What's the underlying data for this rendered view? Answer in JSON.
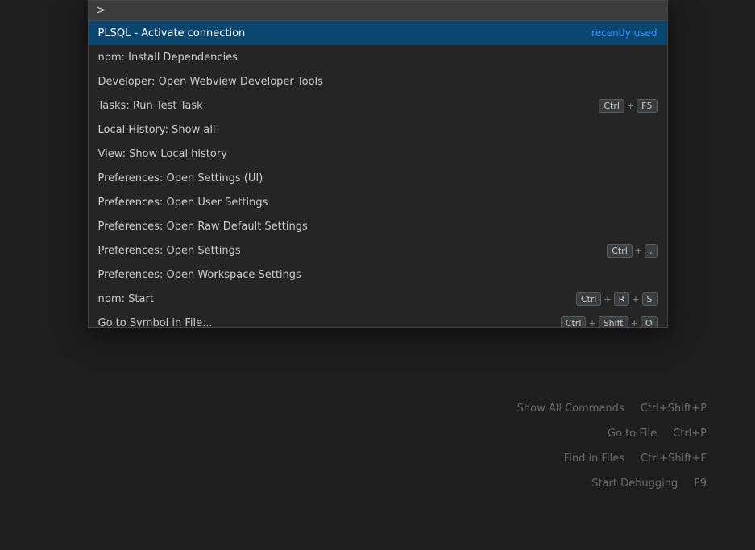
{
  "background": {
    "color": "#1e1e1e"
  },
  "commandPalette": {
    "searchBar": {
      "prefix": ">",
      "placeholder": "",
      "value": ""
    },
    "commands": [
      {
        "id": "plsql-activate",
        "name": "PLSQL - Activate connection",
        "badge": "recently used",
        "keybinding": null,
        "selected": true
      },
      {
        "id": "npm-install",
        "name": "npm: Install Dependencies",
        "badge": null,
        "keybinding": null,
        "selected": false
      },
      {
        "id": "dev-open-webview",
        "name": "Developer: Open Webview Developer Tools",
        "badge": null,
        "keybinding": null,
        "selected": false
      },
      {
        "id": "tasks-run-test",
        "name": "Tasks: Run Test Task",
        "badge": null,
        "keybinding": [
          {
            "key": "Ctrl"
          },
          {
            "sep": "+"
          },
          {
            "key": "F5"
          }
        ],
        "selected": false
      },
      {
        "id": "local-history-show-all",
        "name": "Local History: Show all",
        "badge": null,
        "keybinding": null,
        "selected": false
      },
      {
        "id": "view-show-local-history",
        "name": "View: Show Local history",
        "badge": null,
        "keybinding": null,
        "selected": false
      },
      {
        "id": "prefs-open-settings-ui",
        "name": "Preferences: Open Settings (UI)",
        "badge": null,
        "keybinding": null,
        "selected": false
      },
      {
        "id": "prefs-open-user-settings",
        "name": "Preferences: Open User Settings",
        "badge": null,
        "keybinding": null,
        "selected": false
      },
      {
        "id": "prefs-open-raw-default",
        "name": "Preferences: Open Raw Default Settings",
        "badge": null,
        "keybinding": null,
        "selected": false
      },
      {
        "id": "prefs-open-settings",
        "name": "Preferences: Open Settings",
        "badge": null,
        "keybinding": [
          {
            "key": "Ctrl"
          },
          {
            "sep": "+"
          },
          {
            "key": ","
          }
        ],
        "selected": false
      },
      {
        "id": "prefs-open-workspace",
        "name": "Preferences: Open Workspace Settings",
        "badge": null,
        "keybinding": null,
        "selected": false
      },
      {
        "id": "npm-start",
        "name": "npm: Start",
        "badge": null,
        "keybinding": [
          {
            "key": "Ctrl"
          },
          {
            "sep": "+"
          },
          {
            "key": "R"
          },
          {
            "sep": "+"
          },
          {
            "key": "S"
          }
        ],
        "selected": false
      },
      {
        "id": "go-to-symbol",
        "name": "Go to Symbol in File...",
        "badge": null,
        "keybinding": [
          {
            "key": "Ctrl"
          },
          {
            "sep": "+"
          },
          {
            "key": "Shift"
          },
          {
            "sep": "+"
          },
          {
            "key": "O"
          }
        ],
        "selected": false
      }
    ]
  },
  "hints": [
    {
      "label": "Show All Commands",
      "shortcut": "Ctrl+Shift+P"
    },
    {
      "label": "Go to File",
      "shortcut": "Ctrl+P"
    },
    {
      "label": "Find in Files",
      "shortcut": "Ctrl+Shift+F"
    },
    {
      "label": "Start Debugging",
      "shortcut": "F9"
    }
  ]
}
